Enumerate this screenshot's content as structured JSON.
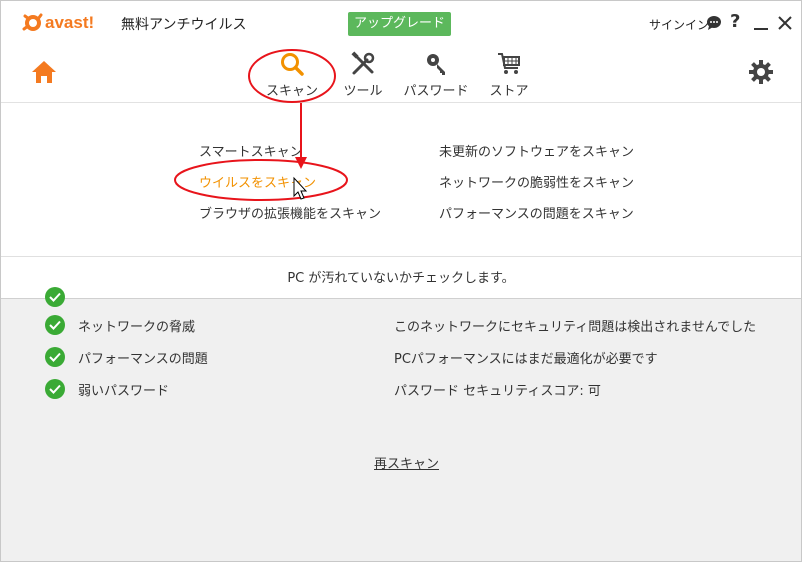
{
  "app": {
    "logo_text": "avast!",
    "title": "無料アンチウイルス",
    "upgrade_label": "アップグレード",
    "signin_label": "サインイン"
  },
  "nav": {
    "items": [
      {
        "label": "スキャン",
        "icon": "search-icon"
      },
      {
        "label": "ツール",
        "icon": "tools-icon"
      },
      {
        "label": "パスワード",
        "icon": "key-icon"
      },
      {
        "label": "ストア",
        "icon": "cart-icon"
      }
    ]
  },
  "scan_menu": {
    "left": [
      "スマートスキャン",
      "ウイルスをスキャン",
      "ブラウザの拡張機能をスキャン"
    ],
    "right": [
      "未更新のソフトウェアをスキャン",
      "ネットワークの脆弱性をスキャン",
      "パフォーマンスの問題をスキャン"
    ],
    "active_item": "ウイルスをスキャン",
    "description": "PC が汚れていないかチェックします。"
  },
  "results": [
    {
      "label": "ネットワークの脅威",
      "status": "このネットワークにセキュリティ問題は検出されませんでした"
    },
    {
      "label": "パフォーマンスの問題",
      "status": "PCパフォーマンスにはまだ最適化が必要です"
    },
    {
      "label": "弱いパスワード",
      "status": "パスワード セキュリティスコア: 可"
    }
  ],
  "rescan_label": "再スキャン",
  "colors": {
    "accent_orange": "#f29100",
    "upgrade_green": "#5cb85c",
    "check_green": "#3aaa35",
    "annotation_red": "#e8141b"
  }
}
